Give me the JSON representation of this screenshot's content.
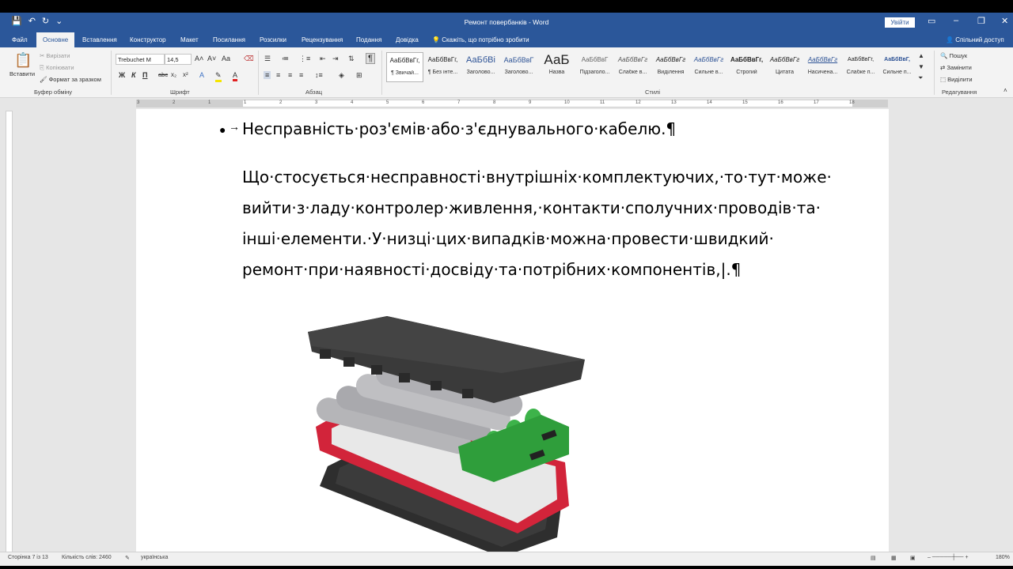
{
  "window": {
    "title": "Ремонт повербанків  -  Word",
    "signin": "Увійти",
    "share": "Спільний доступ"
  },
  "tabs": [
    "Файл",
    "Основне",
    "Вставлення",
    "Конструктор",
    "Макет",
    "Посилання",
    "Розсилки",
    "Рецензування",
    "Подання",
    "Довідка"
  ],
  "tellme": "Скажіть, що потрібно зробити",
  "ribbon": {
    "clipboard": {
      "paste": "Вставити",
      "cut": "Вирізати",
      "copy": "Копіювати",
      "format_painter": "Формат за зразком",
      "label": "Буфер обміну"
    },
    "font": {
      "name": "Trebuchet M",
      "size": "14,5",
      "label": "Шрифт",
      "bold": "Ж",
      "italic": "К",
      "underline": "П",
      "strike": "abc",
      "sub": "x₂",
      "sup": "x²"
    },
    "paragraph": {
      "label": "Абзац",
      "pilcrow": "¶"
    },
    "styles": {
      "label": "Стилі",
      "items": [
        {
          "sample": "АаБбВвГг,",
          "name": "¶ Звичай..."
        },
        {
          "sample": "АаБбВвГг,",
          "name": "¶ Без інте..."
        },
        {
          "sample": "АаБбВі",
          "name": "Заголово..."
        },
        {
          "sample": "АаБбВвГ",
          "name": "Заголово..."
        },
        {
          "sample": "АаБ",
          "name": "Назва"
        },
        {
          "sample": "АаБбВвГ",
          "name": "Підзаголо..."
        },
        {
          "sample": "АаБбВвГг",
          "name": "Слабке в..."
        },
        {
          "sample": "АаБбВвГг",
          "name": "Виділення"
        },
        {
          "sample": "АаБбВвГг",
          "name": "Сильне в..."
        },
        {
          "sample": "АаБбВвГг,",
          "name": "Строгий"
        },
        {
          "sample": "АаБбВвГг",
          "name": "Цитата"
        },
        {
          "sample": "АаБбВвГг",
          "name": "Насичена..."
        },
        {
          "sample": "АаБбВвГг,",
          "name": "Слабке п..."
        },
        {
          "sample": "АаБбВвГ,",
          "name": "Сильне п..."
        }
      ]
    },
    "editing": {
      "find": "Пошук",
      "replace": "Замінити",
      "select": "Виділити",
      "label": "Редагування"
    }
  },
  "ruler_numbers": [
    "3",
    "2",
    "1",
    "1",
    "2",
    "3",
    "4",
    "5",
    "6",
    "7",
    "8",
    "9",
    "10",
    "11",
    "12",
    "13",
    "14",
    "15",
    "16",
    "17",
    "18"
  ],
  "document": {
    "bullet_line": "Несправність·роз'ємів·або·з'єднувального·кабелю.¶",
    "paragraph_lines": [
      "Що·стосується·несправності·внутрішніх·комплектуючих,·то·тут·може·",
      "вийти·з·ладу·контролер·живлення,·контакти·сполучних·проводів·та·",
      "інші·елементи.·У·низці·цих·випадків·можна·провести·швидкий·",
      "ремонт·при·наявності·досвіду·та·потрібних·компонентів,|.¶"
    ]
  },
  "statusbar": {
    "page": "Сторінка 7 із 13",
    "words": "Кількість слів: 2460",
    "language": "українська",
    "zoom": "180%"
  },
  "colors": {
    "brand": "#2b579a",
    "battery_cell": "#b5b5b8",
    "cell_cap": "#3db34a",
    "pcb": "#2f9e3b",
    "case_red": "#d2243a",
    "case_black": "#2e2e2e"
  }
}
